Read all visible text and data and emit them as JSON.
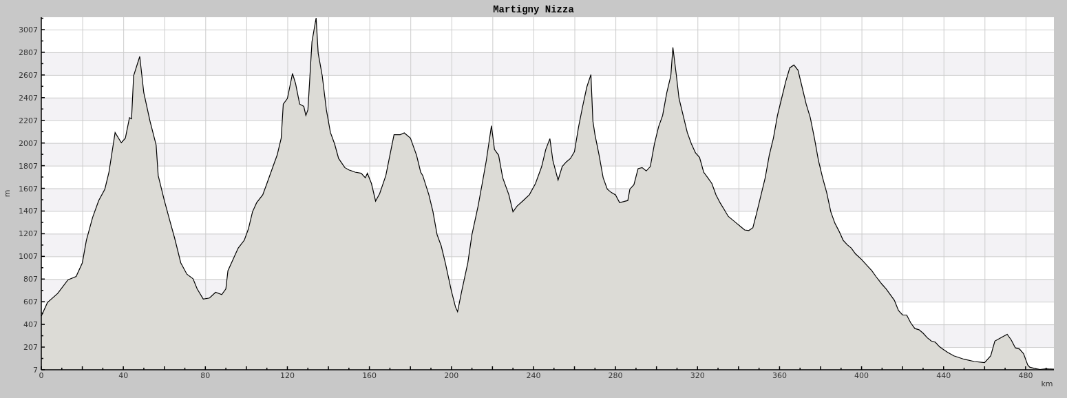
{
  "chart_data": {
    "type": "area",
    "title": "Martigny Nizza",
    "xlabel": "km",
    "ylabel": "m",
    "grid": true,
    "xlim": [
      0,
      493.8
    ],
    "ylim": [
      7,
      3116
    ],
    "xticks": [
      0,
      40,
      80,
      120,
      160,
      200,
      240,
      280,
      320,
      360,
      400,
      440,
      480
    ],
    "yticks": [
      7,
      207,
      407,
      607,
      807,
      1007,
      1207,
      1407,
      1607,
      1807,
      2007,
      2207,
      2407,
      2607,
      2807,
      3007
    ],
    "x": [
      0,
      3,
      8,
      13,
      17,
      20,
      22,
      25,
      28,
      31,
      33,
      36,
      39,
      41,
      43,
      44,
      45,
      48,
      50,
      53,
      56,
      57,
      60,
      63,
      65,
      68,
      71,
      74,
      76,
      79,
      82,
      85,
      88,
      90,
      91,
      94,
      96,
      99,
      101,
      103,
      105,
      108,
      110,
      113,
      115,
      117,
      118,
      120,
      122.5,
      124,
      126,
      128,
      129,
      130,
      132,
      134,
      135,
      137,
      139,
      141,
      143,
      145,
      148,
      150,
      153,
      156,
      158,
      159,
      161,
      163,
      165,
      168,
      170,
      172,
      175,
      177,
      180,
      183,
      185,
      186,
      189,
      191,
      193,
      195,
      197,
      200,
      202,
      203,
      205,
      208,
      210,
      213,
      215,
      217,
      219.5,
      221,
      223,
      225,
      228,
      230,
      232,
      235,
      238,
      241,
      244,
      246,
      248,
      249.5,
      252,
      254,
      256,
      258,
      260,
      262,
      264,
      266,
      268,
      269,
      270,
      272,
      274,
      276,
      278,
      280,
      282,
      286,
      287,
      289,
      291,
      293,
      295,
      297,
      299,
      301,
      303,
      305,
      307,
      308,
      309.7,
      311,
      313,
      315,
      317,
      319,
      321,
      323,
      325,
      327,
      329,
      331,
      333,
      335,
      337,
      339,
      341,
      343,
      345,
      347,
      349,
      351,
      353,
      355,
      357,
      359,
      361,
      363,
      365,
      367,
      369,
      371,
      373,
      375,
      377,
      379,
      381,
      383,
      385,
      387,
      389,
      391,
      393,
      395,
      397,
      400,
      403,
      405,
      407,
      410,
      412,
      414,
      416,
      418,
      420,
      422,
      424,
      426,
      428,
      430,
      432,
      434,
      436,
      438,
      440,
      442,
      445,
      450,
      455,
      460,
      463,
      465,
      467,
      469,
      471,
      473,
      475,
      477,
      479,
      481,
      482,
      484,
      487,
      490,
      493.8
    ],
    "series": [
      {
        "color": "#dcdbd6",
        "values": [
          480,
          600,
          680,
          800,
          830,
          950,
          1150,
          1350,
          1500,
          1600,
          1750,
          2100,
          2010,
          2050,
          2230,
          2220,
          2600,
          2770,
          2450,
          2200,
          1990,
          1720,
          1500,
          1300,
          1170,
          950,
          850,
          810,
          720,
          630,
          640,
          690,
          670,
          720,
          880,
          1000,
          1080,
          1150,
          1250,
          1400,
          1480,
          1550,
          1650,
          1800,
          1900,
          2050,
          2350,
          2400,
          2620,
          2530,
          2350,
          2330,
          2250,
          2300,
          2900,
          3110,
          2800,
          2600,
          2300,
          2100,
          2000,
          1870,
          1790,
          1770,
          1750,
          1740,
          1700,
          1740,
          1650,
          1495,
          1560,
          1720,
          1900,
          2080,
          2080,
          2096,
          2050,
          1900,
          1750,
          1720,
          1550,
          1400,
          1200,
          1100,
          950,
          700,
          560,
          520,
          700,
          950,
          1200,
          1450,
          1650,
          1850,
          2160,
          1950,
          1900,
          1700,
          1550,
          1400,
          1450,
          1500,
          1550,
          1650,
          1800,
          1950,
          2045,
          1850,
          1680,
          1800,
          1840,
          1870,
          1930,
          2150,
          2330,
          2500,
          2610,
          2200,
          2080,
          1900,
          1700,
          1600,
          1570,
          1550,
          1480,
          1500,
          1600,
          1640,
          1780,
          1790,
          1760,
          1800,
          2000,
          2150,
          2250,
          2450,
          2600,
          2850,
          2600,
          2400,
          2250,
          2100,
          2000,
          1920,
          1880,
          1750,
          1700,
          1650,
          1550,
          1480,
          1420,
          1360,
          1330,
          1300,
          1270,
          1240,
          1235,
          1260,
          1400,
          1550,
          1700,
          1900,
          2050,
          2250,
          2400,
          2550,
          2670,
          2695,
          2650,
          2500,
          2350,
          2230,
          2050,
          1850,
          1700,
          1570,
          1400,
          1300,
          1230,
          1150,
          1110,
          1080,
          1030,
          980,
          920,
          880,
          830,
          760,
          720,
          670,
          620,
          530,
          490,
          490,
          420,
          370,
          360,
          330,
          290,
          260,
          250,
          210,
          185,
          160,
          130,
          100,
          80,
          70,
          130,
          260,
          280,
          300,
          320,
          270,
          200,
          190,
          150,
          50,
          30,
          20,
          10,
          15,
          12
        ]
      }
    ]
  }
}
